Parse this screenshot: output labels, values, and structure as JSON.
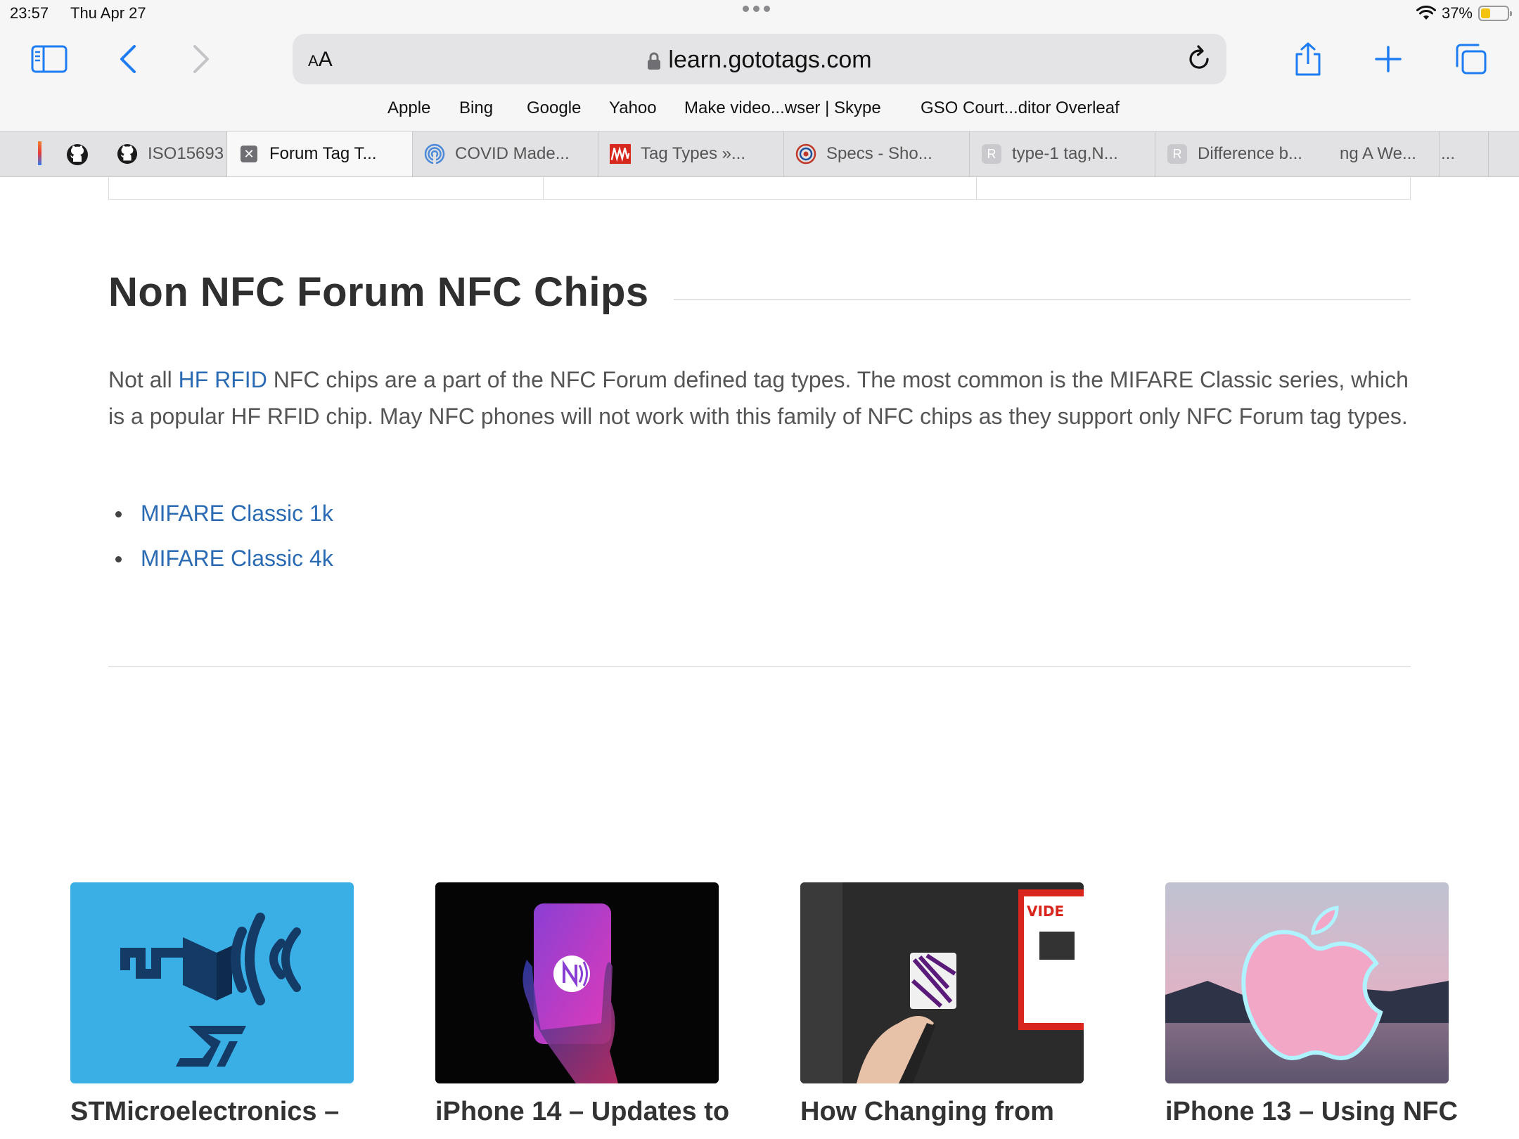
{
  "status": {
    "time": "23:57",
    "date": "Thu Apr 27",
    "battery": "37%",
    "battery_level": 0.37
  },
  "browser": {
    "url": "learn.gototags.com",
    "aa_label": "AA",
    "favorites": [
      "Apple",
      "Bing",
      "Google",
      "Yahoo",
      "Make video...wser | Skype",
      "GSO Court...ditor Overleaf"
    ],
    "tabs": [
      {
        "label": "ISO15693",
        "icon": "github-icon"
      },
      {
        "label": "Forum Tag T...",
        "icon": "close-icon",
        "active": true
      },
      {
        "label": "COVID Made...",
        "icon": "fingerprint-icon"
      },
      {
        "label": "Tag Types »...",
        "icon": "wave-icon"
      },
      {
        "label": "Specs - Sho...",
        "icon": "target-icon"
      },
      {
        "label": "type-1 tag,N...",
        "icon": "r-icon",
        "icon_letter": "R"
      },
      {
        "label": "Difference b...",
        "icon": "r-icon",
        "icon_letter": "R"
      },
      {
        "label": "ng A We...",
        "icon": ""
      },
      {
        "label": "...",
        "icon": ""
      }
    ]
  },
  "article": {
    "heading": "Non NFC Forum NFC Chips",
    "para_pre": "Not all ",
    "para_link": "HF RFID",
    "para_post": " NFC chips are a part of the NFC Forum defined tag types. The most common is the MIFARE Classic series, which is a popular HF RFID chip. May NFC phones will not work with this family of NFC chips as they support only NFC Forum tag types.",
    "links": [
      "MIFARE Classic 1k",
      "MIFARE Classic 4k"
    ]
  },
  "related": [
    {
      "title": "STMicroelectronics –",
      "image": "st-nfc-logo"
    },
    {
      "title": "iPhone 14 – Updates to",
      "image": "phone-nfc-hand"
    },
    {
      "title": "How Changing from",
      "image": "hand-marker-tag"
    },
    {
      "title": "iPhone 13 – Using NFC",
      "image": "apple-logo-glow"
    }
  ],
  "colors": {
    "link": "#2a6bb3",
    "accent": "#1e7cf2",
    "st_blue": "#3aafe6"
  }
}
